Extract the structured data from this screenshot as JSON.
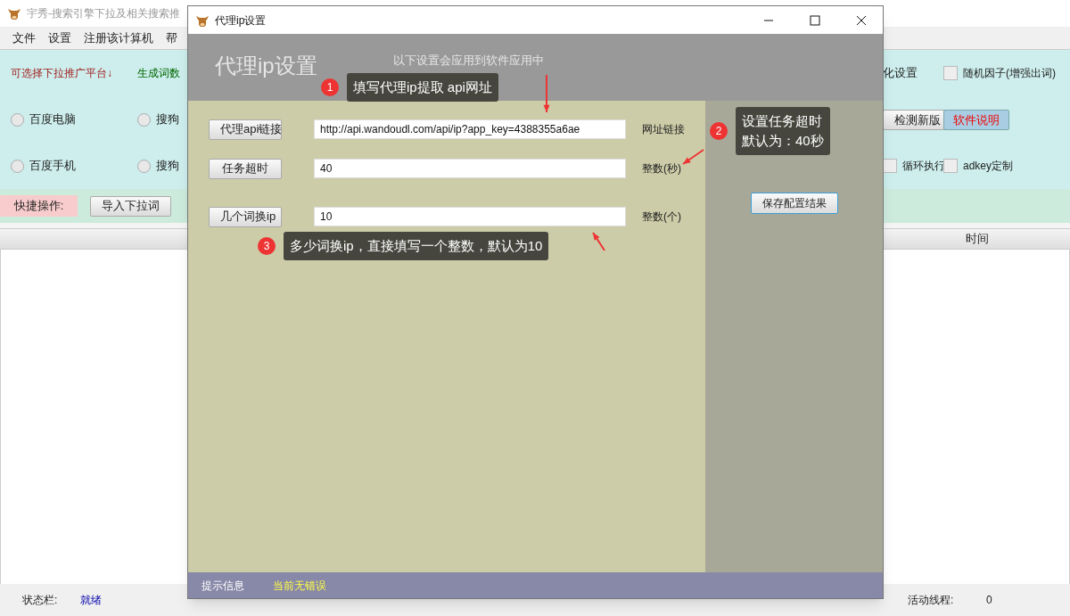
{
  "main_window": {
    "title": "宇秀-搜索引擎下拉及相关搜索推",
    "menu": [
      "文件",
      "设置",
      "注册该计算机",
      "帮"
    ],
    "platform_label": "可选择下拉推广平台↓",
    "count_label": "生成词数",
    "radios": [
      {
        "label": "百度电脑",
        "selected": false
      },
      {
        "label": "搜狗",
        "selected": false
      },
      {
        "label": "百度手机",
        "selected": false
      },
      {
        "label": "搜狗",
        "selected": false
      }
    ],
    "settings_label": "化设置",
    "checkboxes": [
      {
        "label": "随机因子(增强出词)",
        "checked": false
      },
      {
        "label": "循环执行",
        "checked": false
      },
      {
        "label": "adkey定制",
        "checked": false
      }
    ],
    "buttons": [
      {
        "label": "检测新版",
        "kind": "plain"
      },
      {
        "label": "软件说明",
        "kind": "accent"
      }
    ],
    "quick_label": "快捷操作:",
    "quick_button": "导入下拉词",
    "table": {
      "columns": [
        "时间"
      ]
    },
    "status_bar": [
      {
        "label": "状态栏:",
        "value": "就绪"
      },
      {
        "label": "活动线程:",
        "value": "0"
      }
    ]
  },
  "dialog": {
    "title": "代理ip设置",
    "heading": "代理ip设置",
    "subtitle": "以下设置会应用到软件应用中",
    "rows": [
      {
        "button": "代理api链接",
        "value": "http://api.wandoudl.com/api/ip?app_key=4388355a6ae",
        "unit": "网址链接"
      },
      {
        "button": "任务超时",
        "value": "40",
        "unit": "整数(秒)"
      },
      {
        "button": "几个词换ip",
        "value": "10",
        "unit": "整数(个)"
      }
    ],
    "save_button": "保存配置结果",
    "footer": {
      "label": "提示信息",
      "message": "当前无错误"
    }
  },
  "annotations": [
    {
      "number": "1",
      "lines": [
        "填写代理ip提取 api网址"
      ]
    },
    {
      "number": "2",
      "lines": [
        "设置任务超时",
        "默认为：40秒"
      ]
    },
    {
      "number": "3",
      "lines": [
        "多少词换ip，直接填写一个整数，默认为10"
      ]
    }
  ]
}
